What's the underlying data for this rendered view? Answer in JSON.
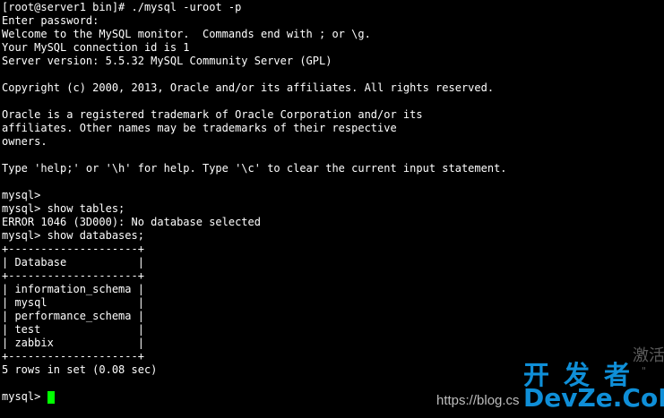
{
  "terminal": {
    "lines": [
      "[root@server1 bin]# ./mysql -uroot -p",
      "Enter password:",
      "Welcome to the MySQL monitor.  Commands end with ; or \\g.",
      "Your MySQL connection id is 1",
      "Server version: 5.5.32 MySQL Community Server (GPL)",
      "",
      "Copyright (c) 2000, 2013, Oracle and/or its affiliates. All rights reserved.",
      "",
      "Oracle is a registered trademark of Oracle Corporation and/or its",
      "affiliates. Other names may be trademarks of their respective",
      "owners.",
      "",
      "Type 'help;' or '\\h' for help. Type '\\c' to clear the current input statement.",
      "",
      "mysql>",
      "mysql> show tables;",
      "ERROR 1046 (3D000): No database selected",
      "mysql> show databases;",
      "+--------------------+",
      "| Database           |",
      "+--------------------+",
      "| information_schema |",
      "| mysql              |",
      "| performance_schema |",
      "| test               |",
      "| zabbix             |",
      "+--------------------+",
      "5 rows in set (0.08 sec)",
      ""
    ],
    "prompt": "mysql> ",
    "cursor_color": "#00ff00",
    "background_color": "#000000",
    "text_color": "#ffffff"
  },
  "watermarks": {
    "activate_text": "激活",
    "activate_sub": "\"",
    "url": "https://blog.cs",
    "logo_cn": "开发者",
    "logo_en": "DevZe.CoM",
    "logo_color": "#0f8fd8"
  }
}
